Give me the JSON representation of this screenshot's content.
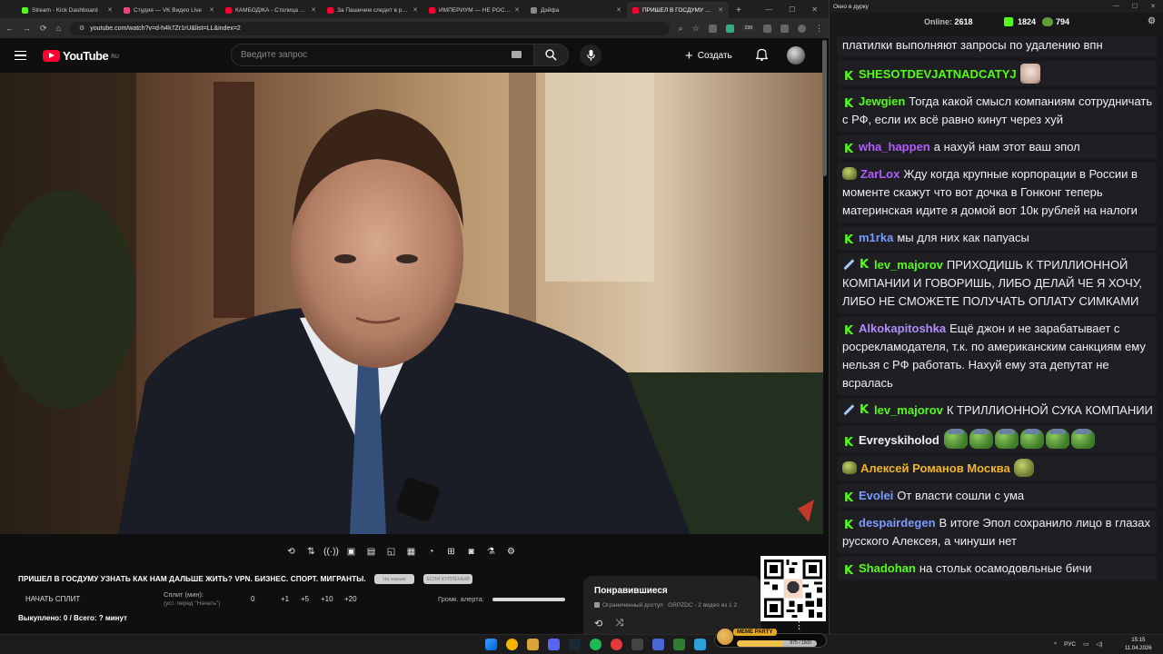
{
  "browser": {
    "tabs": [
      {
        "title": "Stream - Kick Dashboard",
        "color": "#53fc18",
        "active": false
      },
      {
        "title": "Студия — VK Видео Live",
        "color": "#e84a7a",
        "active": false
      },
      {
        "title": "КАМБОДЖА - Столица Миро",
        "color": "#ff0033",
        "active": false
      },
      {
        "title": "За Пашичем следит в реальн",
        "color": "#ff0033",
        "active": false
      },
      {
        "title": "ИМПЕРИУМ — НЕ РОССИЯ",
        "color": "#ff0033",
        "active": false
      },
      {
        "title": "Дэйфа",
        "color": "#888888",
        "active": false
      },
      {
        "title": "ПРИШЕЛ В ГОСДУМУ УЗНАТ",
        "color": "#ff0033",
        "active": true
      }
    ],
    "url": "youtube.com/watch?v=d-h4k7Zr1rU&list=LL&index=2",
    "extension_badge": "239"
  },
  "youtube": {
    "logo_text": "YouTube",
    "country": "RU",
    "search_placeholder": "Введите запрос",
    "create_label": "Создать"
  },
  "controls": [
    "loop-icon",
    "sort-icon",
    "broadcast-icon",
    "cinema-icon",
    "clapper-icon",
    "pip-icon",
    "subtitles-icon",
    "speed-icon",
    "screenshot-frame-icon",
    "camera-icon",
    "flask-icon",
    "gear-icon"
  ],
  "video_info": {
    "title": "ПРИШЕЛ В ГОСДУМУ УЗНАТЬ КАК НАМ ДАЛЬШЕ ЖИТЬ? VPN. БИЗНЕС. СПОРТ. МИГРАНТЫ.",
    "pill_a": "На заказе",
    "pill_b": "ЕСЛИ КУПЛЕНЫЙ",
    "split_button": "НАЧАТЬ СПЛИТ",
    "split_label": "Сплит (мин):",
    "split_hint": "(уст. перед \"Начать\")",
    "split_values": [
      "0",
      "+1",
      "+5",
      "+10",
      "+20"
    ],
    "alert_volume_label": "Громк. алерта:",
    "bought": "Выкуплено: 0 / Всего: ? минут"
  },
  "liked_panel": {
    "title": "Понравившиеся",
    "access": "Ограниченный доступ",
    "meta": "GRPZDC - 2 видео из 1 2"
  },
  "chat": {
    "window_title": "Окно в дурку",
    "online_label": "Online:",
    "online_count": "2618",
    "kick_count": "1824",
    "pepe_count": "794",
    "messages": [
      {
        "user": "",
        "color": "#efeff1",
        "text": "платилки выполняют запросы по удалению впн"
      },
      {
        "user": "SHESOTDEVJATNADCATYJ",
        "color": "#53fc18",
        "text": ""
      },
      {
        "user": "Jewgien",
        "color": "#53fc18",
        "text": "Тогда какой смысл компаниям сотрудничать с РФ, если их всё равно кинут через хуй"
      },
      {
        "user": "wha_happen",
        "color": "#b05cff",
        "text": "а нахуй нам этот ваш эпол"
      },
      {
        "user": "ZarLox",
        "color": "#b05cff",
        "text": "Жду когда крупные корпорации в России в моменте скажут что вот дочка в Гонконг теперь материнская идите я домой вот 10к рублей на налоги"
      },
      {
        "user": "m1rka",
        "color": "#7b9bff",
        "text": "мы для них как папуасы"
      },
      {
        "user": "lev_majorov",
        "color": "#53fc18",
        "text": "ПРИХОДИШЬ К ТРИЛЛИОННОЙ КОМПАНИИ И ГОВОРИШЬ, ЛИБО ДЕЛАЙ ЧЕ Я ХОЧУ, ЛИБО НЕ СМОЖЕТЕ ПОЛУЧАТЬ ОПЛАТУ СИМКАМИ"
      },
      {
        "user": "Alkokapitoshka",
        "color": "#b38cff",
        "text": "Ещё джон и не зарабатывает с росрекламодателя, т.к. по американским санкциям ему нельзя с РФ работать. Нахуй ему эта депутат не всралась"
      },
      {
        "user": "lev_majorov",
        "color": "#53fc18",
        "text": "К ТРИЛЛИОННОЙ СУКА КОМПАНИИ"
      },
      {
        "user": "Evreyskiholod",
        "color": "#efeff1",
        "text": ""
      },
      {
        "user": "Алексей Романов Москва",
        "color": "#f0b429",
        "text": ""
      },
      {
        "user": "Evolei",
        "color": "#7b9bff",
        "text": "От власти сошли с ума"
      },
      {
        "user": "despairdegen",
        "color": "#7b9bff",
        "text": "В итоге Эпол сохранило лицо в глазах русского Алексея, а чинуши нет"
      },
      {
        "user": "Shadohan",
        "color": "#53fc18",
        "text": "на стольк осамодовльные бичи"
      }
    ]
  },
  "widget": {
    "label": "MEME PARTY",
    "progress_text": "875 / 1500",
    "progress": 0.58
  },
  "taskbar": {
    "lang": "РУС",
    "time": "15:15",
    "date": "11.04.2026"
  }
}
